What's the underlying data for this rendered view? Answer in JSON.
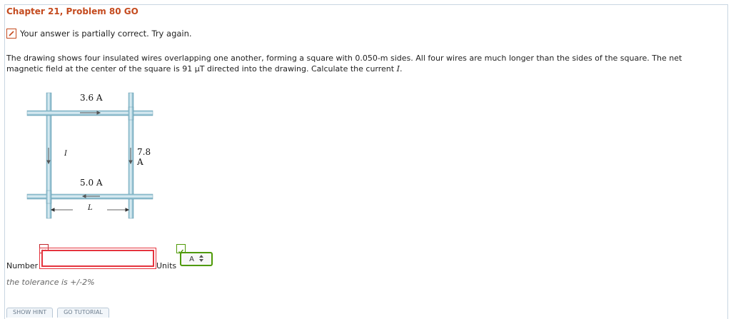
{
  "header": {
    "title": "Chapter 21, Problem 80 GO"
  },
  "status": {
    "message": "Your answer is partially correct.  Try again."
  },
  "problem": {
    "text_before": "The drawing shows four insulated wires overlapping one another, forming a square with 0.050-m sides. All four wires are much longer than the sides of the square. The net magnetic field at the center of the square is 91 μT directed into the drawing. Calculate the current ",
    "current_var": "I",
    "text_after": "."
  },
  "figure": {
    "top_current": "3.6 A",
    "right_current": "7.8 A",
    "bottom_current": "5.0 A",
    "left_current": "I",
    "side_length": "L"
  },
  "answer": {
    "number_label": "Number",
    "number_value": "",
    "units_label": "Units",
    "units_value": "A",
    "tolerance": "the tolerance is +/-2%"
  },
  "tabs": [
    "SHOW HINT",
    "GO TUTORIAL"
  ]
}
